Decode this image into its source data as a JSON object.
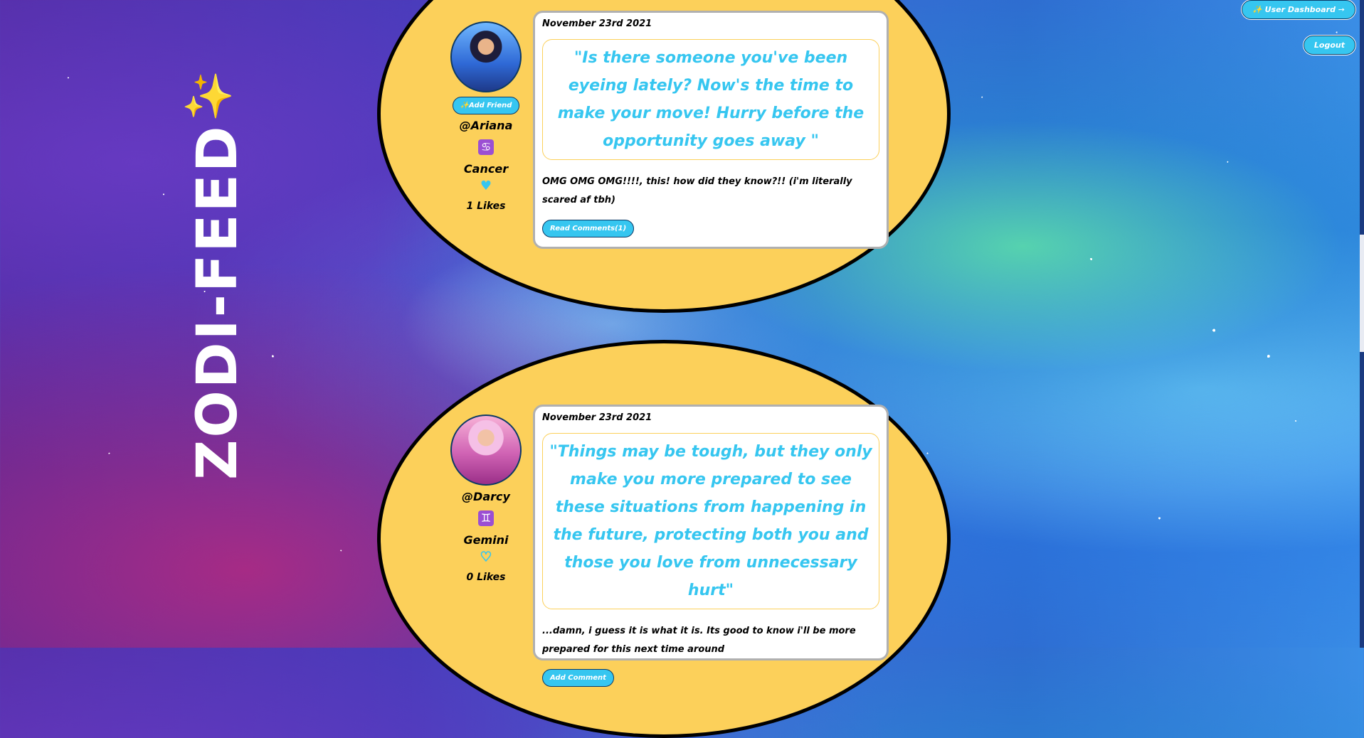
{
  "brand": {
    "logo": "ZODI-FEED",
    "sparkle_icon": "sparkles-icon"
  },
  "header": {
    "user_dashboard": "✨ User Dashboard ➙",
    "logout": "Logout"
  },
  "posts": [
    {
      "handle": "@Ariana",
      "add_friend": "✨Add Friend",
      "zodiac_symbol": "♋",
      "sign": "Cancer",
      "liked": true,
      "likes": "1 Likes",
      "date": "November 23rd 2021",
      "horoscope": "\"Is there someone you've been eyeing lately? Now's the time to make your move! Hurry before the opportunity goes away \"",
      "body": "OMG OMG OMG!!!!, this! how did they know?!! (i'm literally scared af tbh)",
      "action_label": "Read Comments(1)"
    },
    {
      "handle": "@Darcy",
      "zodiac_symbol": "♊",
      "sign": "Gemini",
      "liked": false,
      "likes": "0 Likes",
      "date": "November 23rd 2021",
      "horoscope": "\"Things may be tough, but they only make you more prepared to see these situations from happening in the future, protecting both you and those you love from unnecessary hurt\"",
      "body": "...damn, i guess it is what it is. Its good to know i'll be more prepared for this next time around",
      "action_label": "Add Comment"
    }
  ],
  "colors": {
    "accent": "#36c6f0",
    "card_bg": "#fcd05a",
    "zodiac_bg": "#9b4fd3"
  }
}
